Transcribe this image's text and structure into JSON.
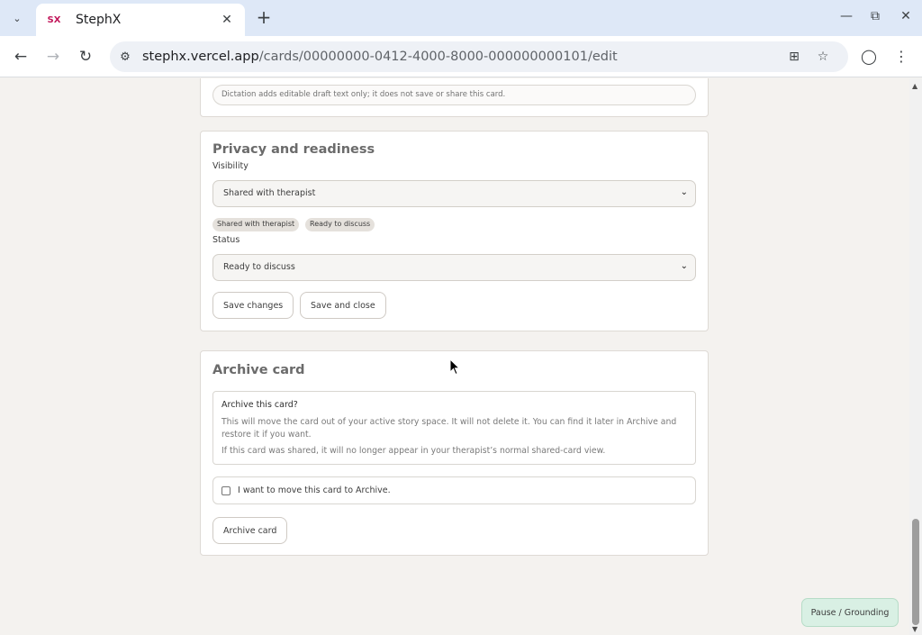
{
  "browser": {
    "tab_title": "StephX",
    "favicon": "SX",
    "url_host": "stephx.vercel.app",
    "url_path": "/cards/00000000-0412-4000-8000-000000000101/edit"
  },
  "dictation": {
    "note": "Dictation adds editable draft text only; it does not save or share this card."
  },
  "privacy": {
    "title": "Privacy and readiness",
    "visibility_label": "Visibility",
    "visibility_value": "Shared with therapist",
    "chips": [
      "Shared with therapist",
      "Ready to discuss"
    ],
    "status_label": "Status",
    "status_value": "Ready to discuss",
    "save_changes": "Save changes",
    "save_and_close": "Save and close"
  },
  "archive": {
    "title": "Archive card",
    "question": "Archive this card?",
    "paragraph1": "This will move the card out of your active story space. It will not delete it. You can find it later in Archive and restore it if you want.",
    "paragraph2": "If this card was shared, it will no longer appear in your therapist’s normal shared-card view.",
    "confirm_label": "I want to move this card to Archive.",
    "confirm_checked": false,
    "button": "Archive card"
  },
  "floating": {
    "pause_button": "Pause / Grounding"
  },
  "colors": {
    "page_bg": "#f4f2ef",
    "tabbar_bg": "#dee8f7",
    "pause_bg": "#d9f0e4",
    "chip_bg": "#e5e1dc"
  }
}
